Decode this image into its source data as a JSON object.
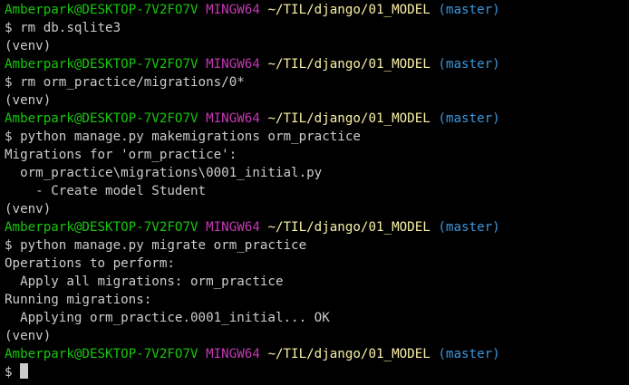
{
  "colors": {
    "background": "#000000",
    "text": "#cccccc",
    "user_host": "#16c60c",
    "system": "#c239b3",
    "path": "#f9f1a5",
    "branch": "#3a96dd"
  },
  "prompt": {
    "user_host": "Amberpark@DESKTOP-7V2FO7V",
    "system": "MINGW64",
    "path": "~/TIL/django/01_MODEL",
    "branch": "(master)",
    "symbol": "$"
  },
  "lines": [
    {
      "type": "prompt"
    },
    {
      "type": "command",
      "text": "rm db.sqlite3"
    },
    {
      "type": "output",
      "text": "(venv)"
    },
    {
      "type": "prompt"
    },
    {
      "type": "command",
      "text": "rm orm_practice/migrations/0*"
    },
    {
      "type": "output",
      "text": "(venv)"
    },
    {
      "type": "prompt"
    },
    {
      "type": "command",
      "text": "python manage.py makemigrations orm_practice"
    },
    {
      "type": "output",
      "text": "Migrations for 'orm_practice':"
    },
    {
      "type": "output",
      "text": "  orm_practice\\migrations\\0001_initial.py"
    },
    {
      "type": "output",
      "text": "    - Create model Student"
    },
    {
      "type": "output",
      "text": "(venv)"
    },
    {
      "type": "prompt"
    },
    {
      "type": "command",
      "text": "python manage.py migrate orm_practice"
    },
    {
      "type": "output",
      "text": "Operations to perform:"
    },
    {
      "type": "output",
      "text": "  Apply all migrations: orm_practice"
    },
    {
      "type": "output",
      "text": "Running migrations:"
    },
    {
      "type": "output",
      "text": "  Applying orm_practice.0001_initial... OK"
    },
    {
      "type": "output",
      "text": "(venv)"
    },
    {
      "type": "prompt"
    },
    {
      "type": "input",
      "text": ""
    }
  ]
}
